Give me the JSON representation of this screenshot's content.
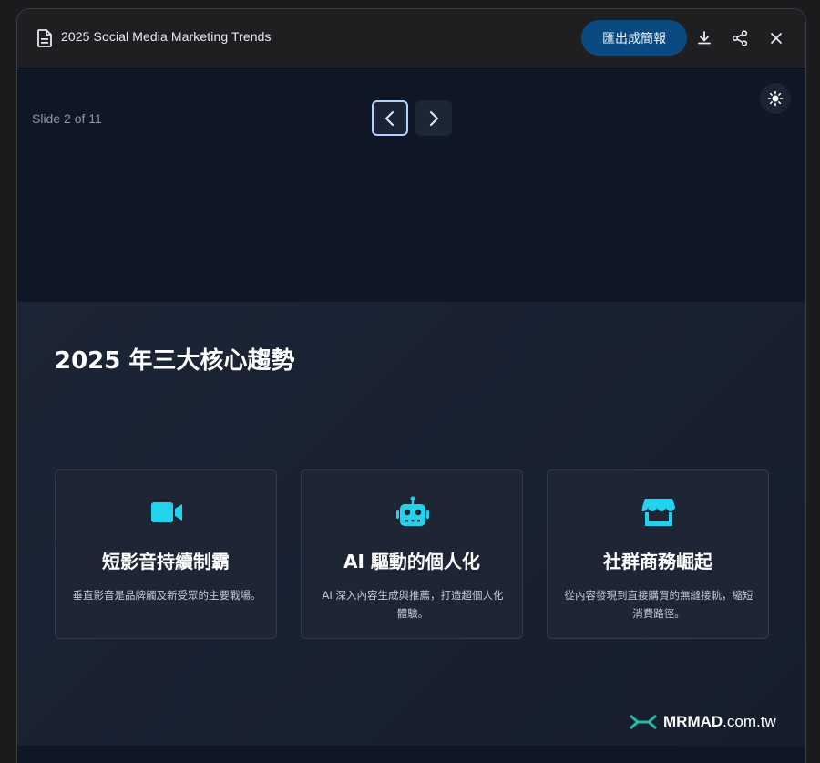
{
  "titlebar": {
    "doc_title": "2025 Social Media Marketing Trends",
    "export_label": "匯出成簡報",
    "icons": [
      "document-icon",
      "download-icon",
      "share-icon",
      "close-icon"
    ]
  },
  "stage": {
    "slide_counter": "Slide 2 of 11",
    "icons": [
      "chevron-left-icon",
      "chevron-right-icon",
      "sun-icon"
    ]
  },
  "slide": {
    "heading": "2025 年三大核心趨勢",
    "cards": [
      {
        "icon": "video-camera-icon",
        "title": "短影音持續制霸",
        "desc": "垂直影音是品牌觸及新受眾的主要戰場。"
      },
      {
        "icon": "robot-icon",
        "title": "AI 驅動的個人化",
        "desc": "AI 深入內容生成與推薦，打造超個人化體驗。"
      },
      {
        "icon": "storefront-icon",
        "title": "社群商務崛起",
        "desc": "從內容發現到直接購買的無縫接軌，縮短消費路徑。"
      }
    ],
    "accent_color": "#22d3ee"
  },
  "watermark": {
    "brand": "MRMAD",
    "domain": ".com.tw",
    "logo_color": "#2bb8a8"
  }
}
